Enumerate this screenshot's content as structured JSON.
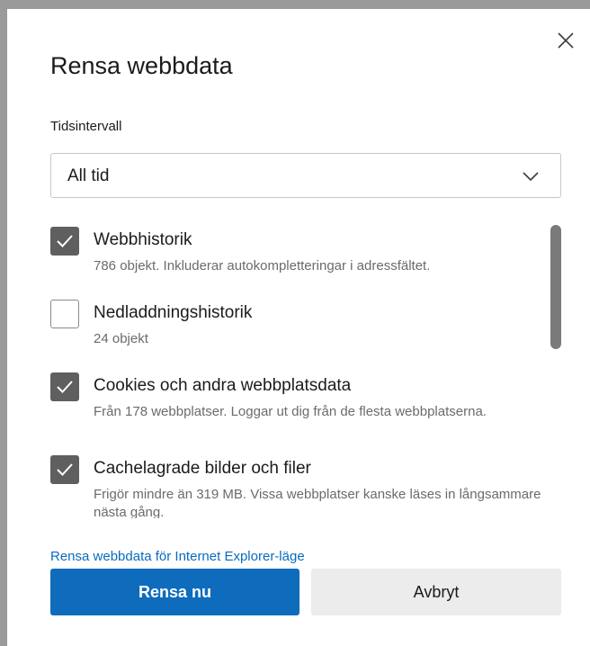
{
  "dialog": {
    "title": "Rensa webbdata",
    "close_icon": "close-icon"
  },
  "time_range": {
    "label": "Tidsintervall",
    "selected": "All tid",
    "chevron_icon": "chevron-down-icon"
  },
  "items": [
    {
      "label": "Webbhistorik",
      "description": "786 objekt. Inkluderar autokompletteringar i adressfältet.",
      "checked": true
    },
    {
      "label": "Nedladdningshistorik",
      "description": "24 objekt",
      "checked": false
    },
    {
      "label": "Cookies och andra webbplatsdata",
      "description": "Från 178 webbplatser. Loggar ut dig från de flesta webbplatserna.",
      "checked": true
    },
    {
      "label": "Cachelagrade bilder och filer",
      "description": "Frigör mindre än 319 MB. Vissa webbplatser kanske läses in långsammare nästa gång.",
      "checked": true
    }
  ],
  "ie_link": "Rensa webbdata för Internet Explorer-läge",
  "buttons": {
    "primary": "Rensa nu",
    "secondary": "Avbryt"
  },
  "colors": {
    "primary": "#0f6cbd",
    "link": "#0a6bbd",
    "checkbox_checked": "#5f5f5f"
  }
}
